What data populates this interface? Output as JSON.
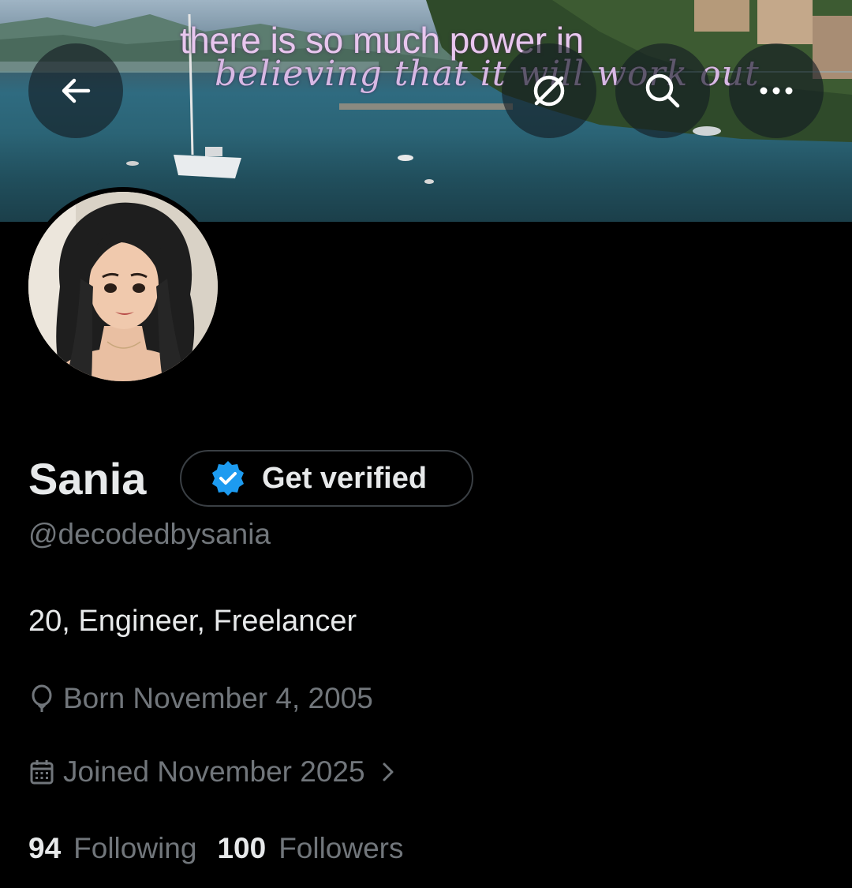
{
  "banner": {
    "quote_line1": "there is so much power in",
    "quote_line2": "believing that it will work out"
  },
  "header": {
    "back_icon": "arrow-left-icon",
    "reload_icon": "sync-icon",
    "search_icon": "search-icon",
    "more_icon": "more-horizontal-icon"
  },
  "profile": {
    "name": "Sania",
    "verify_label": "Get verified",
    "handle": "@decodedbysania",
    "bio": "20, Engineer, Freelancer",
    "born": "Born November 4, 2005",
    "joined": "Joined November 2025",
    "following_count": "94",
    "following_label": "Following",
    "followers_count": "100",
    "followers_label": "Followers"
  },
  "colors": {
    "background": "#000000",
    "primary_text": "#e7e9ea",
    "secondary_text": "#71767b",
    "verified_blue": "#1d9bf0"
  }
}
